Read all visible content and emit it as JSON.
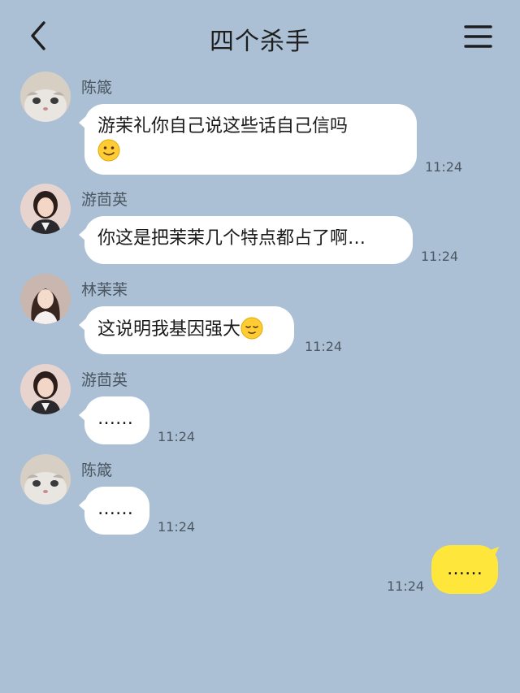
{
  "header": {
    "title": "四个杀手",
    "back_icon": "chevron-left-icon",
    "menu_icon": "hamburger-menu-icon"
  },
  "messages": [
    {
      "sender": "陈箴",
      "avatar": "cat-avatar",
      "text": "游茉礼你自己说这些话自己信吗",
      "emoji": "slightly-smiling-face",
      "time": "11:24"
    },
    {
      "sender": "游茴英",
      "avatar": "woman-avatar-1",
      "text": "你这是把茉茉几个特点都占了啊…",
      "time": "11:24"
    },
    {
      "sender": "林茉茉",
      "avatar": "woman-avatar-2",
      "text": "这说明我基因强大",
      "emoji": "relieved-face",
      "time": "11:24"
    },
    {
      "sender": "游茴英",
      "avatar": "woman-avatar-1",
      "text": "……",
      "time": "11:24"
    },
    {
      "sender": "陈箴",
      "avatar": "cat-avatar",
      "text": "……",
      "time": "11:24"
    }
  ],
  "self_message": {
    "text": "……",
    "time": "11:24"
  },
  "colors": {
    "background": "#abc0d4",
    "self_bubble": "#ffe63a",
    "other_bubble": "#ffffff"
  }
}
